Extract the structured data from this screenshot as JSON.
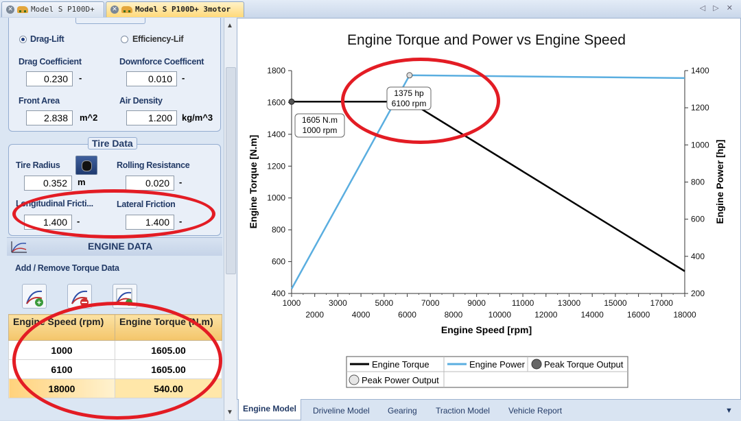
{
  "doc_tabs": [
    {
      "label": "Model S P100D+"
    },
    {
      "label": "Model S P100D+ 3motor"
    }
  ],
  "left": {
    "aero_mode": {
      "option1": "Drag-Lift",
      "option2": "Efficiency-Lif",
      "selected": "Drag-Lift"
    },
    "drag_coefficient": {
      "label": "Drag Coefficient",
      "value": "0.230",
      "unit": "-"
    },
    "downforce_coefficient": {
      "label": "Downforce Coefficent",
      "value": "0.010",
      "unit": "-"
    },
    "front_area": {
      "label": "Front Area",
      "value": "2.838",
      "unit": "m^2"
    },
    "air_density": {
      "label": "Air Density",
      "value": "1.200",
      "unit": "kg/m^3"
    },
    "tire_group_title": "Tire Data",
    "tire_radius": {
      "label": "Tire Radius",
      "value": "0.352",
      "unit": "m"
    },
    "rolling_resistance": {
      "label": "Rolling Resistance",
      "value": "0.020",
      "unit": "-"
    },
    "longitudinal_friction": {
      "label": "Longitudinal Fricti...",
      "value": "1.400",
      "unit": "-"
    },
    "lateral_friction": {
      "label": "Lateral Friction",
      "value": "1.400",
      "unit": "-"
    },
    "engine_header": "ENGINE DATA",
    "add_remove_label": "Add / Remove Torque Data",
    "table": {
      "headers": [
        "Engine Speed (rpm)",
        "Engine Torque (N.m)"
      ],
      "rows": [
        [
          "1000",
          "1605.00"
        ],
        [
          "6100",
          "1605.00"
        ],
        [
          "18000",
          "540.00"
        ]
      ]
    }
  },
  "bottom_tabs": [
    "Engine Model",
    "Driveline Model",
    "Gearing",
    "Traction Model",
    "Vehicle Report"
  ],
  "chart_data": {
    "type": "line",
    "title": "Engine Torque and Power vs Engine Speed",
    "xlabel": "Engine Speed [rpm]",
    "ylabel": "Engine Torque [N.m]",
    "y2label": "Engine Power [hp]",
    "xlim": [
      1000,
      18000
    ],
    "ylim": [
      400,
      1800
    ],
    "y2lim": [
      200,
      1400
    ],
    "x_ticks_top": [
      "1000",
      "3000",
      "5000",
      "7000",
      "9000",
      "11000",
      "13000",
      "15000",
      "17000"
    ],
    "x_ticks_bottom": [
      "2000",
      "4000",
      "6000",
      "8000",
      "10000",
      "12000",
      "14000",
      "16000",
      "18000"
    ],
    "y_ticks": [
      "400",
      "600",
      "800",
      "1000",
      "1200",
      "1400",
      "1600",
      "1800"
    ],
    "y2_ticks": [
      "200",
      "400",
      "600",
      "800",
      "1000",
      "1200",
      "1400"
    ],
    "grid": false,
    "legend_placement": "bottom-center",
    "series": [
      {
        "name": "Engine Torque",
        "axis": "left",
        "color": "#000000",
        "x": [
          1000,
          6100,
          18000
        ],
        "y": [
          1605,
          1605,
          540
        ]
      },
      {
        "name": "Engine Power",
        "axis": "right",
        "color": "#5aaee0",
        "x": [
          1000,
          6100,
          18000
        ],
        "y": [
          225,
          1375,
          1360
        ]
      },
      {
        "name": "Peak Torque Output",
        "axis": "left",
        "color": "#555555",
        "x": [
          1000
        ],
        "y": [
          1605
        ]
      },
      {
        "name": "Peak Power Output",
        "axis": "right",
        "color": "#dddddd",
        "x": [
          6100
        ],
        "y": [
          1375
        ]
      }
    ],
    "annotations": [
      {
        "line1": "1605 N.m",
        "line2": "1000 rpm"
      },
      {
        "line1": "1375 hp",
        "line2": "6100 rpm"
      }
    ]
  },
  "colors": {
    "highlight_ellipse": "#e31c24",
    "power_line": "#5aaee0",
    "tab_active": "#ffd97a"
  }
}
